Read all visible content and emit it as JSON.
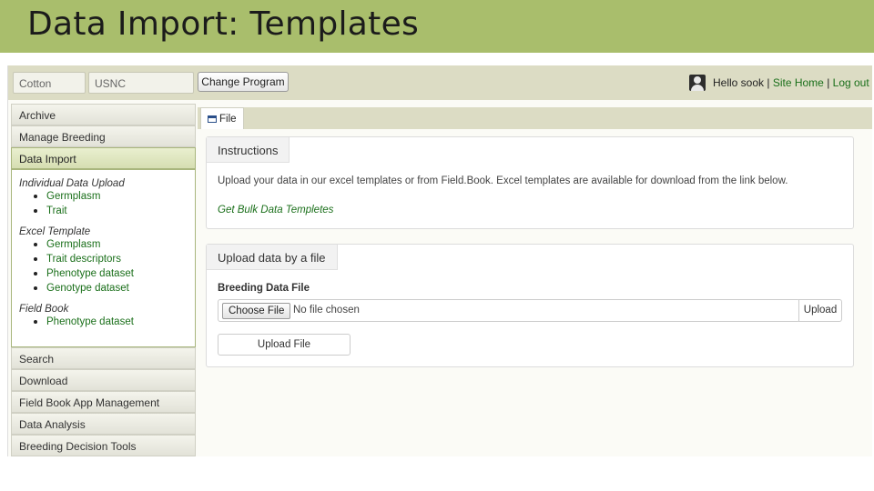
{
  "slide": {
    "title": "Data Import: Templates"
  },
  "topbar": {
    "crop": "Cotton",
    "program": "USNC",
    "change_program": "Change Program",
    "greeting": "Hello sook",
    "sep1": " | ",
    "site_home": "Site Home",
    "sep2": " | ",
    "logout": "Log out"
  },
  "sidebar": {
    "items_before": [
      {
        "label": "Archive"
      },
      {
        "label": "Manage Breeding"
      }
    ],
    "active": "Data Import",
    "groups": [
      {
        "title": "Individual Data Upload",
        "links": [
          "Germplasm",
          "Trait"
        ]
      },
      {
        "title": "Excel Template",
        "links": [
          "Germplasm",
          "Trait descriptors",
          "Phenotype dataset",
          "Genotype dataset"
        ]
      },
      {
        "title": "Field Book",
        "links": [
          "Phenotype dataset"
        ]
      }
    ],
    "items_after": [
      {
        "label": "Search"
      },
      {
        "label": "Download"
      },
      {
        "label": "Field Book App Management"
      },
      {
        "label": "Data Analysis"
      },
      {
        "label": "Breeding Decision Tools"
      }
    ]
  },
  "tab": {
    "label": "File"
  },
  "instructions": {
    "heading": "Instructions",
    "text": "Upload your data in our excel templates or from Field.Book. Excel templates are available for download from the link below.",
    "link": "Get Bulk Data Templetes"
  },
  "upload": {
    "heading": "Upload data by a file",
    "field_label": "Breeding Data File",
    "choose_button": "Choose File",
    "no_file": "No file chosen",
    "addon": "Upload",
    "button": "Upload File"
  },
  "colors": {
    "title_bar": "#a9be6c",
    "link": "#1a6f1a",
    "topbar": "#dcdcc4"
  }
}
